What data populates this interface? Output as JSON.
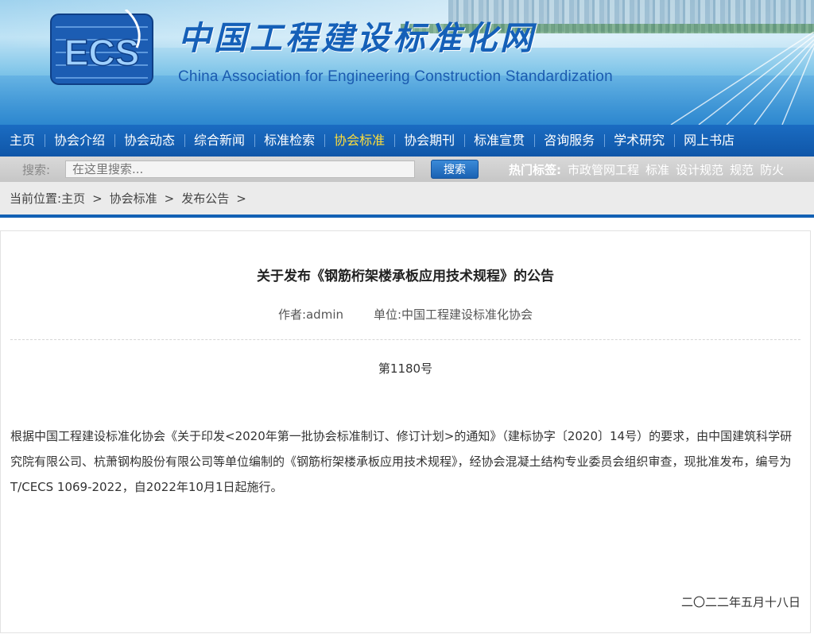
{
  "header": {
    "logo_text": "ECS",
    "title_cn": "中国工程建设标准化网",
    "title_en": "China Association for Engineering Construction Standardization"
  },
  "nav": {
    "items": [
      {
        "label": "主页"
      },
      {
        "label": "协会介绍"
      },
      {
        "label": "协会动态"
      },
      {
        "label": "综合新闻"
      },
      {
        "label": "标准检索"
      },
      {
        "label": "协会标准",
        "active": true
      },
      {
        "label": "协会期刊"
      },
      {
        "label": "标准宣贯"
      },
      {
        "label": "咨询服务"
      },
      {
        "label": "学术研究"
      },
      {
        "label": "网上书店"
      }
    ]
  },
  "search": {
    "label": "搜索:",
    "placeholder": "在这里搜索...",
    "button_label": "搜索",
    "hot_label": "热门标签:",
    "hot_tags": [
      "市政管网工程",
      "标准",
      "设计规范",
      "规范",
      "防火"
    ]
  },
  "breadcrumb": {
    "prefix": "当前位置:",
    "items": [
      "主页",
      "协会标准",
      "发布公告"
    ],
    "separator": ">"
  },
  "article": {
    "title": "关于发布《钢筋桁架楼承板应用技术规程》的公告",
    "author": "作者:admin",
    "unit": "单位:中国工程建设标准化协会",
    "number": "第1180号",
    "body": "根据中国工程建设标准化协会《关于印发<2020年第一批协会标准制订、修订计划>的通知》（建标协字〔2020〕14号）的要求，由中国建筑科学研究院有限公司、杭萧钢构股份有限公司等单位编制的《钢筋桁架楼承板应用技术规程》，经协会混凝土结构专业委员会组织审查，现批准发布，编号为T/CECS 1069-2022，自2022年10月1日起施行。",
    "date": "二〇二二年五月十八日"
  },
  "colors": {
    "nav_bg": "#1260b4",
    "nav_active": "#ffde3a",
    "title_blue": "#1560b8"
  }
}
